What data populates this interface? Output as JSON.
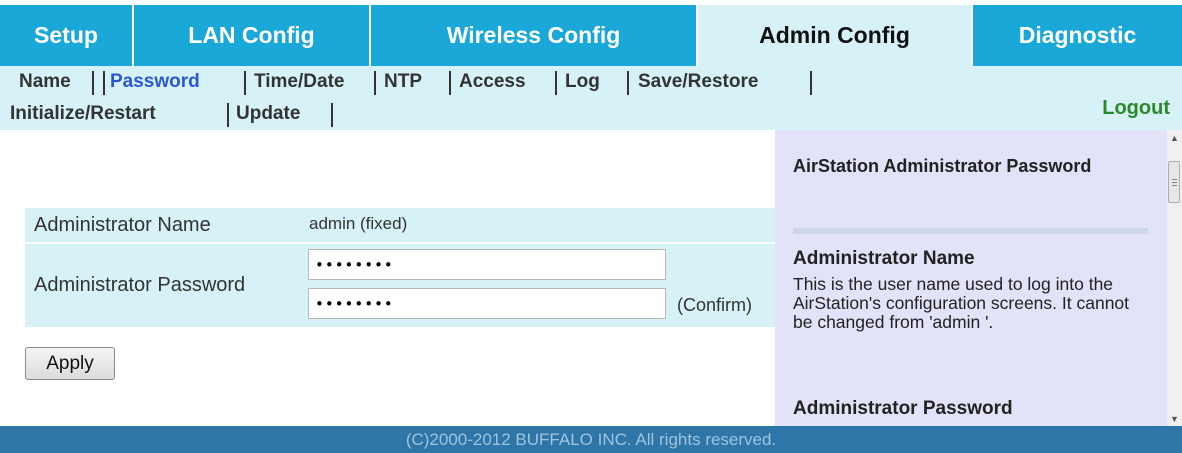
{
  "tabs": [
    {
      "label": "Setup"
    },
    {
      "label": "LAN Config"
    },
    {
      "label": "Wireless Config"
    },
    {
      "label": "Admin Config",
      "active": true
    },
    {
      "label": "Diagnostic"
    }
  ],
  "subnav": {
    "items": [
      {
        "label": "Name"
      },
      {
        "label": "Password",
        "active": true
      },
      {
        "label": "Time/Date"
      },
      {
        "label": "NTP"
      },
      {
        "label": "Access"
      },
      {
        "label": "Log"
      },
      {
        "label": "Save/Restore"
      },
      {
        "label": "Initialize/Restart"
      },
      {
        "label": "Update"
      }
    ],
    "logout_label": "Logout"
  },
  "form": {
    "admin_name_label": "Administrator Name",
    "admin_name_value": "admin (fixed)",
    "admin_password_label": "Administrator Password",
    "password_value": "••••••••",
    "password_confirm_value": "••••••••",
    "confirm_label": "(Confirm)",
    "apply_label": "Apply"
  },
  "help": {
    "title": "AirStation Administrator Password",
    "section1_heading": "Administrator Name",
    "section1_text": "This is the user name used to log into the AirStation's configuration screens. It cannot be changed from 'admin '.",
    "section2_heading": "Administrator Password"
  },
  "footer": {
    "copyright": "(C)2000-2012 BUFFALO INC. All rights reserved."
  },
  "colors": {
    "tab_bg": "#19a8d8",
    "active_tab_bg": "#d6f2f6",
    "active_subnav": "#2a56d6",
    "logout": "#2a8a2a",
    "help_bg": "#e2e2f8",
    "footer_bg": "#2e76a8"
  }
}
